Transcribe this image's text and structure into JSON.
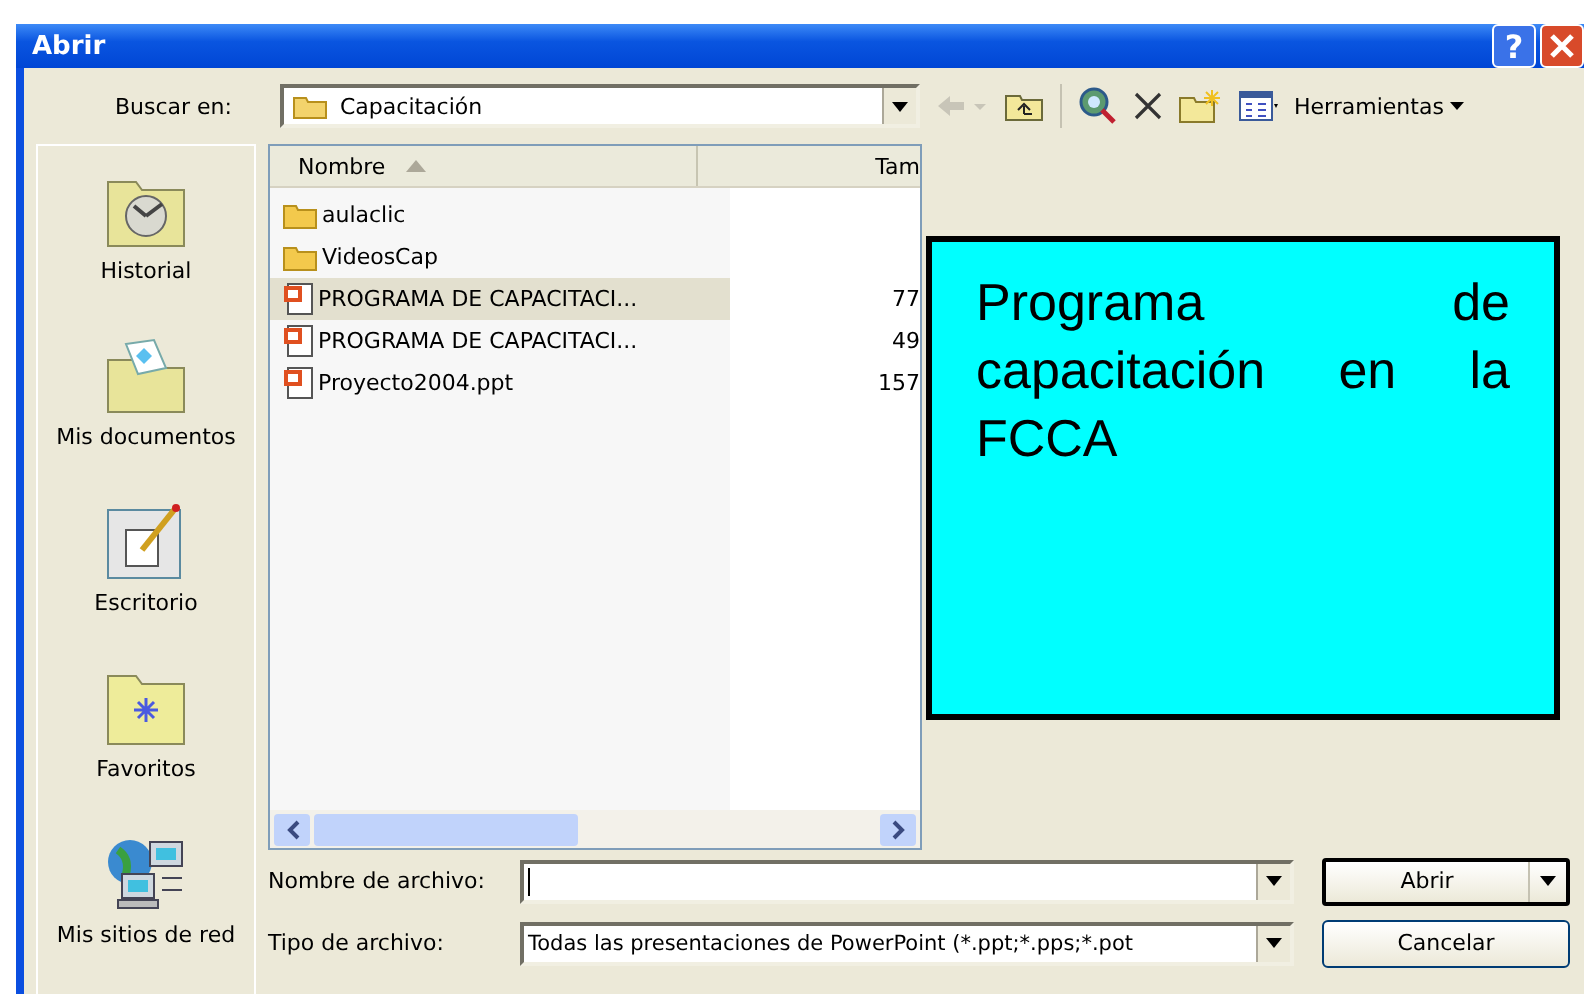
{
  "window": {
    "title": "Abrir",
    "help_glyph": "?"
  },
  "look_in": {
    "label": "Buscar en:",
    "value": "Capacitación"
  },
  "toolbar": {
    "tools_label": "Herramientas"
  },
  "places": [
    {
      "label": "Historial",
      "kind": "history"
    },
    {
      "label": "Mis documentos",
      "kind": "documents"
    },
    {
      "label": "Escritorio",
      "kind": "desktop"
    },
    {
      "label": "Favoritos",
      "kind": "favorites"
    },
    {
      "label": "Mis sitios de red",
      "kind": "network"
    }
  ],
  "file_list": {
    "columns": [
      "Nombre",
      "Tam"
    ],
    "rows": [
      {
        "name": "aulaclic",
        "size": "",
        "kind": "folder",
        "selected": false
      },
      {
        "name": "VideosCap",
        "size": "",
        "kind": "folder",
        "selected": false
      },
      {
        "name": "PROGRAMA DE CAPACITACI...",
        "size": "77",
        "kind": "ppt",
        "selected": true
      },
      {
        "name": "PROGRAMA DE CAPACITACI...",
        "size": "49",
        "kind": "ppt",
        "selected": false
      },
      {
        "name": "Proyecto2004.ppt",
        "size": "157",
        "kind": "ppt",
        "selected": false
      }
    ]
  },
  "preview": {
    "text": "Programa de capacitación en la FCCA"
  },
  "file_name": {
    "label": "Nombre de archivo:"
  },
  "file_type": {
    "label": "Tipo de archivo:",
    "value": "Todas las presentaciones de PowerPoint (*.ppt;*.pps;*.pot"
  },
  "buttons": [
    "Abrir",
    "Cancelar"
  ]
}
